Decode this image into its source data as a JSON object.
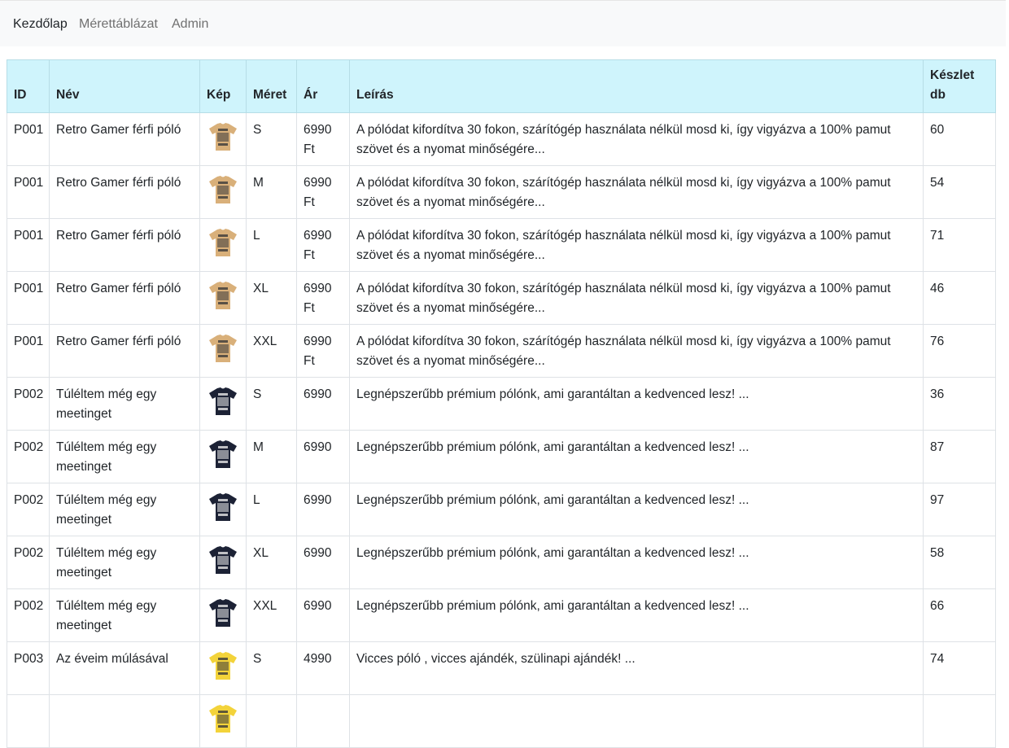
{
  "nav": [
    {
      "label": "Kezdőlap",
      "active": true
    },
    {
      "label": "Mérettáblázat",
      "active": false
    },
    {
      "label": "Admin",
      "active": false
    }
  ],
  "table": {
    "headers": {
      "id": "ID",
      "name": "Név",
      "image": "Kép",
      "size": "Méret",
      "price": "Ár",
      "description": "Leírás",
      "stock": "Készlet db"
    },
    "rows": [
      {
        "id": "P001",
        "name": "Retro Gamer férfi póló",
        "image": "beige-tshirt",
        "size": "S",
        "price": "6990 Ft",
        "description": "A pólódat kifordítva 30 fokon, szárítógép használata nélkül mosd ki, így vigyázva a 100% pamut szövet és a nyomat minőségére...",
        "stock": "60"
      },
      {
        "id": "P001",
        "name": "Retro Gamer férfi póló",
        "image": "beige-tshirt",
        "size": "M",
        "price": "6990 Ft",
        "description": "A pólódat kifordítva 30 fokon, szárítógép használata nélkül mosd ki, így vigyázva a 100% pamut szövet és a nyomat minőségére...",
        "stock": "54"
      },
      {
        "id": "P001",
        "name": "Retro Gamer férfi póló",
        "image": "beige-tshirt",
        "size": "L",
        "price": "6990 Ft",
        "description": "A pólódat kifordítva 30 fokon, szárítógép használata nélkül mosd ki, így vigyázva a 100% pamut szövet és a nyomat minőségére...",
        "stock": "71"
      },
      {
        "id": "P001",
        "name": "Retro Gamer férfi póló",
        "image": "beige-tshirt",
        "size": "XL",
        "price": "6990 Ft",
        "description": "A pólódat kifordítva 30 fokon, szárítógép használata nélkül mosd ki, így vigyázva a 100% pamut szövet és a nyomat minőségére...",
        "stock": "46"
      },
      {
        "id": "P001",
        "name": "Retro Gamer férfi póló",
        "image": "beige-tshirt",
        "size": "XXL",
        "price": "6990 Ft",
        "description": "A pólódat kifordítva 30 fokon, szárítógép használata nélkül mosd ki, így vigyázva a 100% pamut szövet és a nyomat minőségére...",
        "stock": "76"
      },
      {
        "id": "P002",
        "name": "Túléltem még egy meetinget",
        "image": "navy-tshirt",
        "size": "S",
        "price": "6990",
        "description": "Legnépszerűbb prémium pólónk, ami garantáltan a kedvenced lesz! ...",
        "stock": "36"
      },
      {
        "id": "P002",
        "name": "Túléltem még egy meetinget",
        "image": "navy-tshirt",
        "size": "M",
        "price": "6990",
        "description": "Legnépszerűbb prémium pólónk, ami garantáltan a kedvenced lesz! ...",
        "stock": "87"
      },
      {
        "id": "P002",
        "name": "Túléltem még egy meetinget",
        "image": "navy-tshirt",
        "size": "L",
        "price": "6990",
        "description": "Legnépszerűbb prémium pólónk, ami garantáltan a kedvenced lesz! ...",
        "stock": "97"
      },
      {
        "id": "P002",
        "name": "Túléltem még egy meetinget",
        "image": "navy-tshirt",
        "size": "XL",
        "price": "6990",
        "description": "Legnépszerűbb prémium pólónk, ami garantáltan a kedvenced lesz! ...",
        "stock": "58"
      },
      {
        "id": "P002",
        "name": "Túléltem még egy meetinget",
        "image": "navy-tshirt",
        "size": "XXL",
        "price": "6990",
        "description": "Legnépszerűbb prémium pólónk, ami garantáltan a kedvenced lesz! ...",
        "stock": "66"
      },
      {
        "id": "P003",
        "name": "Az éveim múlásával",
        "image": "yellow-tshirt",
        "size": "S",
        "price": "4990",
        "description": "Vicces póló , vicces ajándék, szülinapi ajándék! ...",
        "stock": "74"
      },
      {
        "id": "",
        "name": "",
        "image": "yellow-tshirt",
        "size": "",
        "price": "",
        "description": "",
        "stock": ""
      }
    ]
  },
  "colors": {
    "header_bg": "#cff4fc",
    "navbar_bg": "#f8f9fa",
    "beige_shirt": "#d9b07a",
    "navy_shirt": "#1c2235",
    "yellow_shirt": "#f3d33a"
  }
}
